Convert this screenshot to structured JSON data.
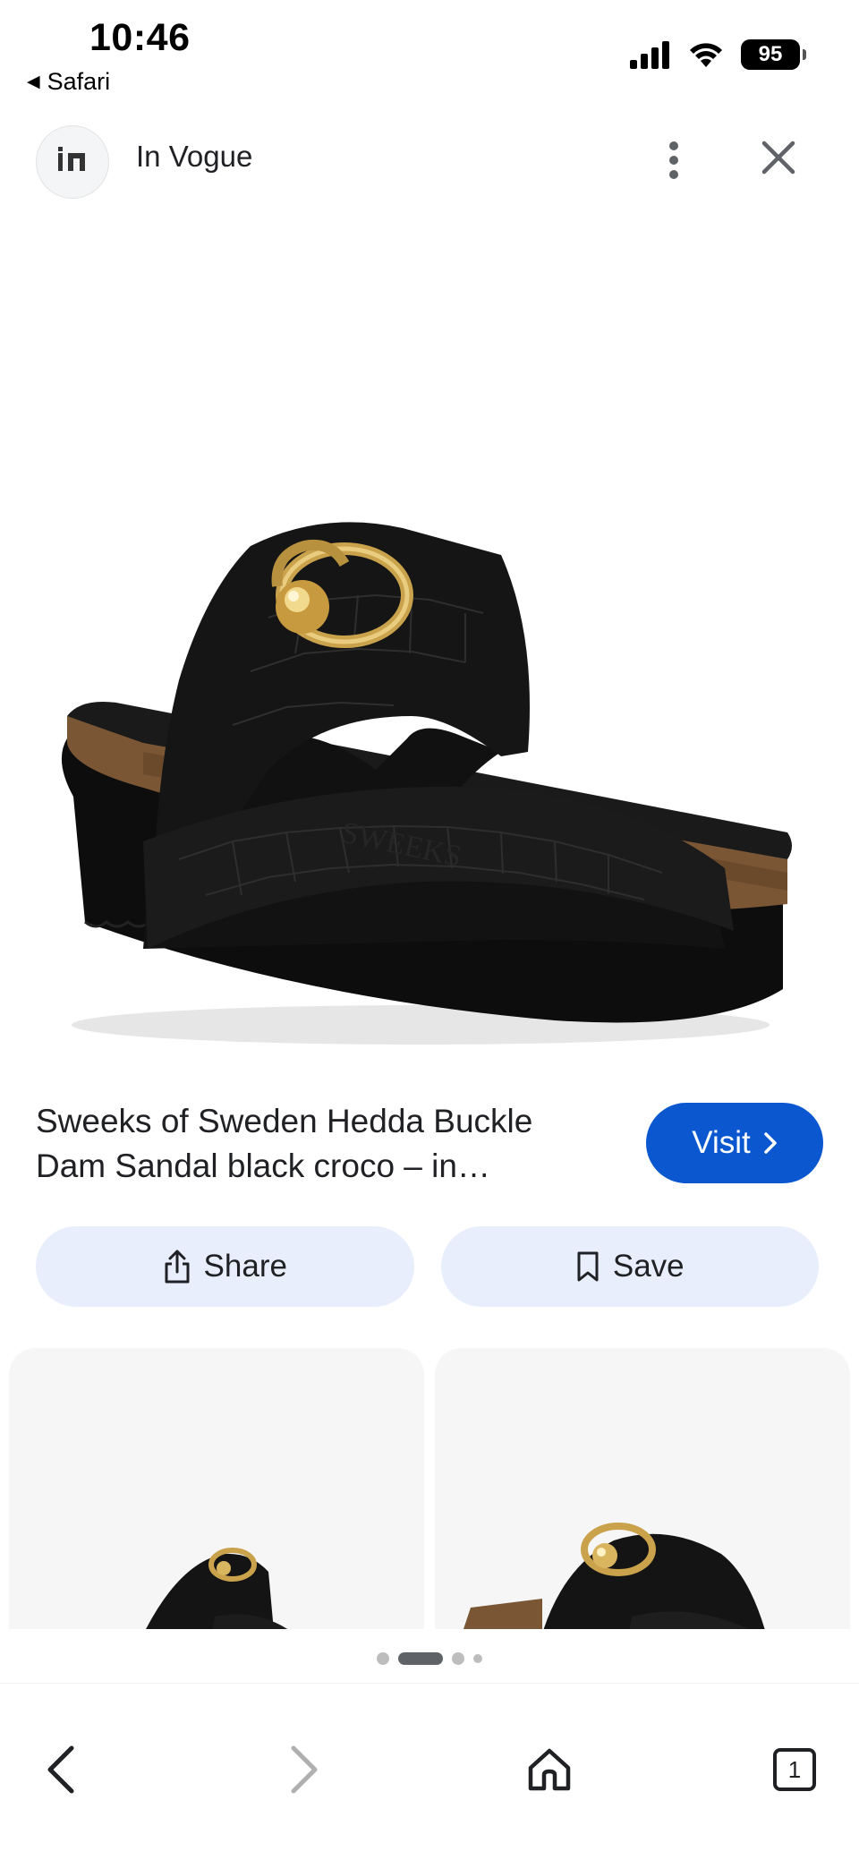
{
  "status_bar": {
    "time": "10:46",
    "back_app": "Safari",
    "battery": "95",
    "icons": [
      "cellular-signal-icon",
      "wifi-icon",
      "battery-icon"
    ]
  },
  "header": {
    "site_name": "In Vogue",
    "logo_icon": "in-vogue-logo-icon",
    "more_icon": "more-vertical-icon",
    "close_icon": "close-icon"
  },
  "hero": {
    "image": "black croco platform sandal with gold buckle",
    "embossed_brand": "SWEEKS"
  },
  "product": {
    "title": "Sweeks of Sweden Hedda Buckle Dam Sandal black croco – in…",
    "visit_label": "Visit"
  },
  "actions": {
    "share_label": "Share",
    "save_label": "Save"
  },
  "pager": {
    "count": 4,
    "active_index": 1
  },
  "bottom_nav": {
    "back_icon": "back-arrow-icon",
    "forward_icon": "forward-arrow-icon",
    "home_icon": "home-icon",
    "tabs_count": "1"
  },
  "colors": {
    "accent": "#0b57d0",
    "chip_bg": "#e8eefc",
    "text": "#202124"
  }
}
